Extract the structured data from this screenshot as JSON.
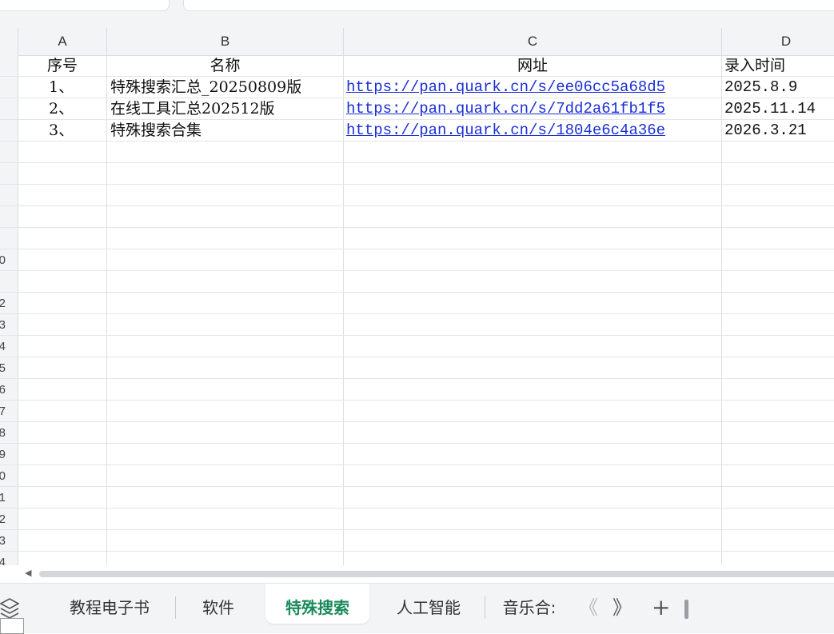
{
  "columns": [
    "A",
    "B",
    "C",
    "D"
  ],
  "row_numbers": [
    "",
    "",
    "",
    "",
    "",
    "",
    "",
    "",
    "",
    "0",
    "",
    "2",
    "3",
    "4",
    "5",
    "6",
    "7",
    "8",
    "9",
    "0",
    "1",
    "2",
    "3",
    "4"
  ],
  "table": {
    "header": [
      "序号",
      "名称",
      "网址",
      "录入时间"
    ],
    "rows": [
      [
        "1、",
        "特殊搜索汇总_20250809版",
        "https://pan.quark.cn/s/ee06cc5a68d5",
        "2025.8.9"
      ],
      [
        "2、",
        "在线工具汇总202512版",
        "https://pan.quark.cn/s/7dd2a61fb1f5",
        "2025.11.14"
      ],
      [
        "3、",
        "特殊搜索合集",
        "https://pan.quark.cn/s/1804e6c4a36e",
        "2026.3.21"
      ]
    ]
  },
  "sheet_tabs": [
    "教程电子书",
    "软件",
    "特殊搜索",
    "人工智能",
    "音乐合:"
  ],
  "active_tab": "特殊搜索",
  "tab_controls": {
    "prev": "《",
    "next": "》",
    "add": "+"
  },
  "colors": {
    "accent": "#1b8a5a",
    "link": "#1a2fd6"
  }
}
